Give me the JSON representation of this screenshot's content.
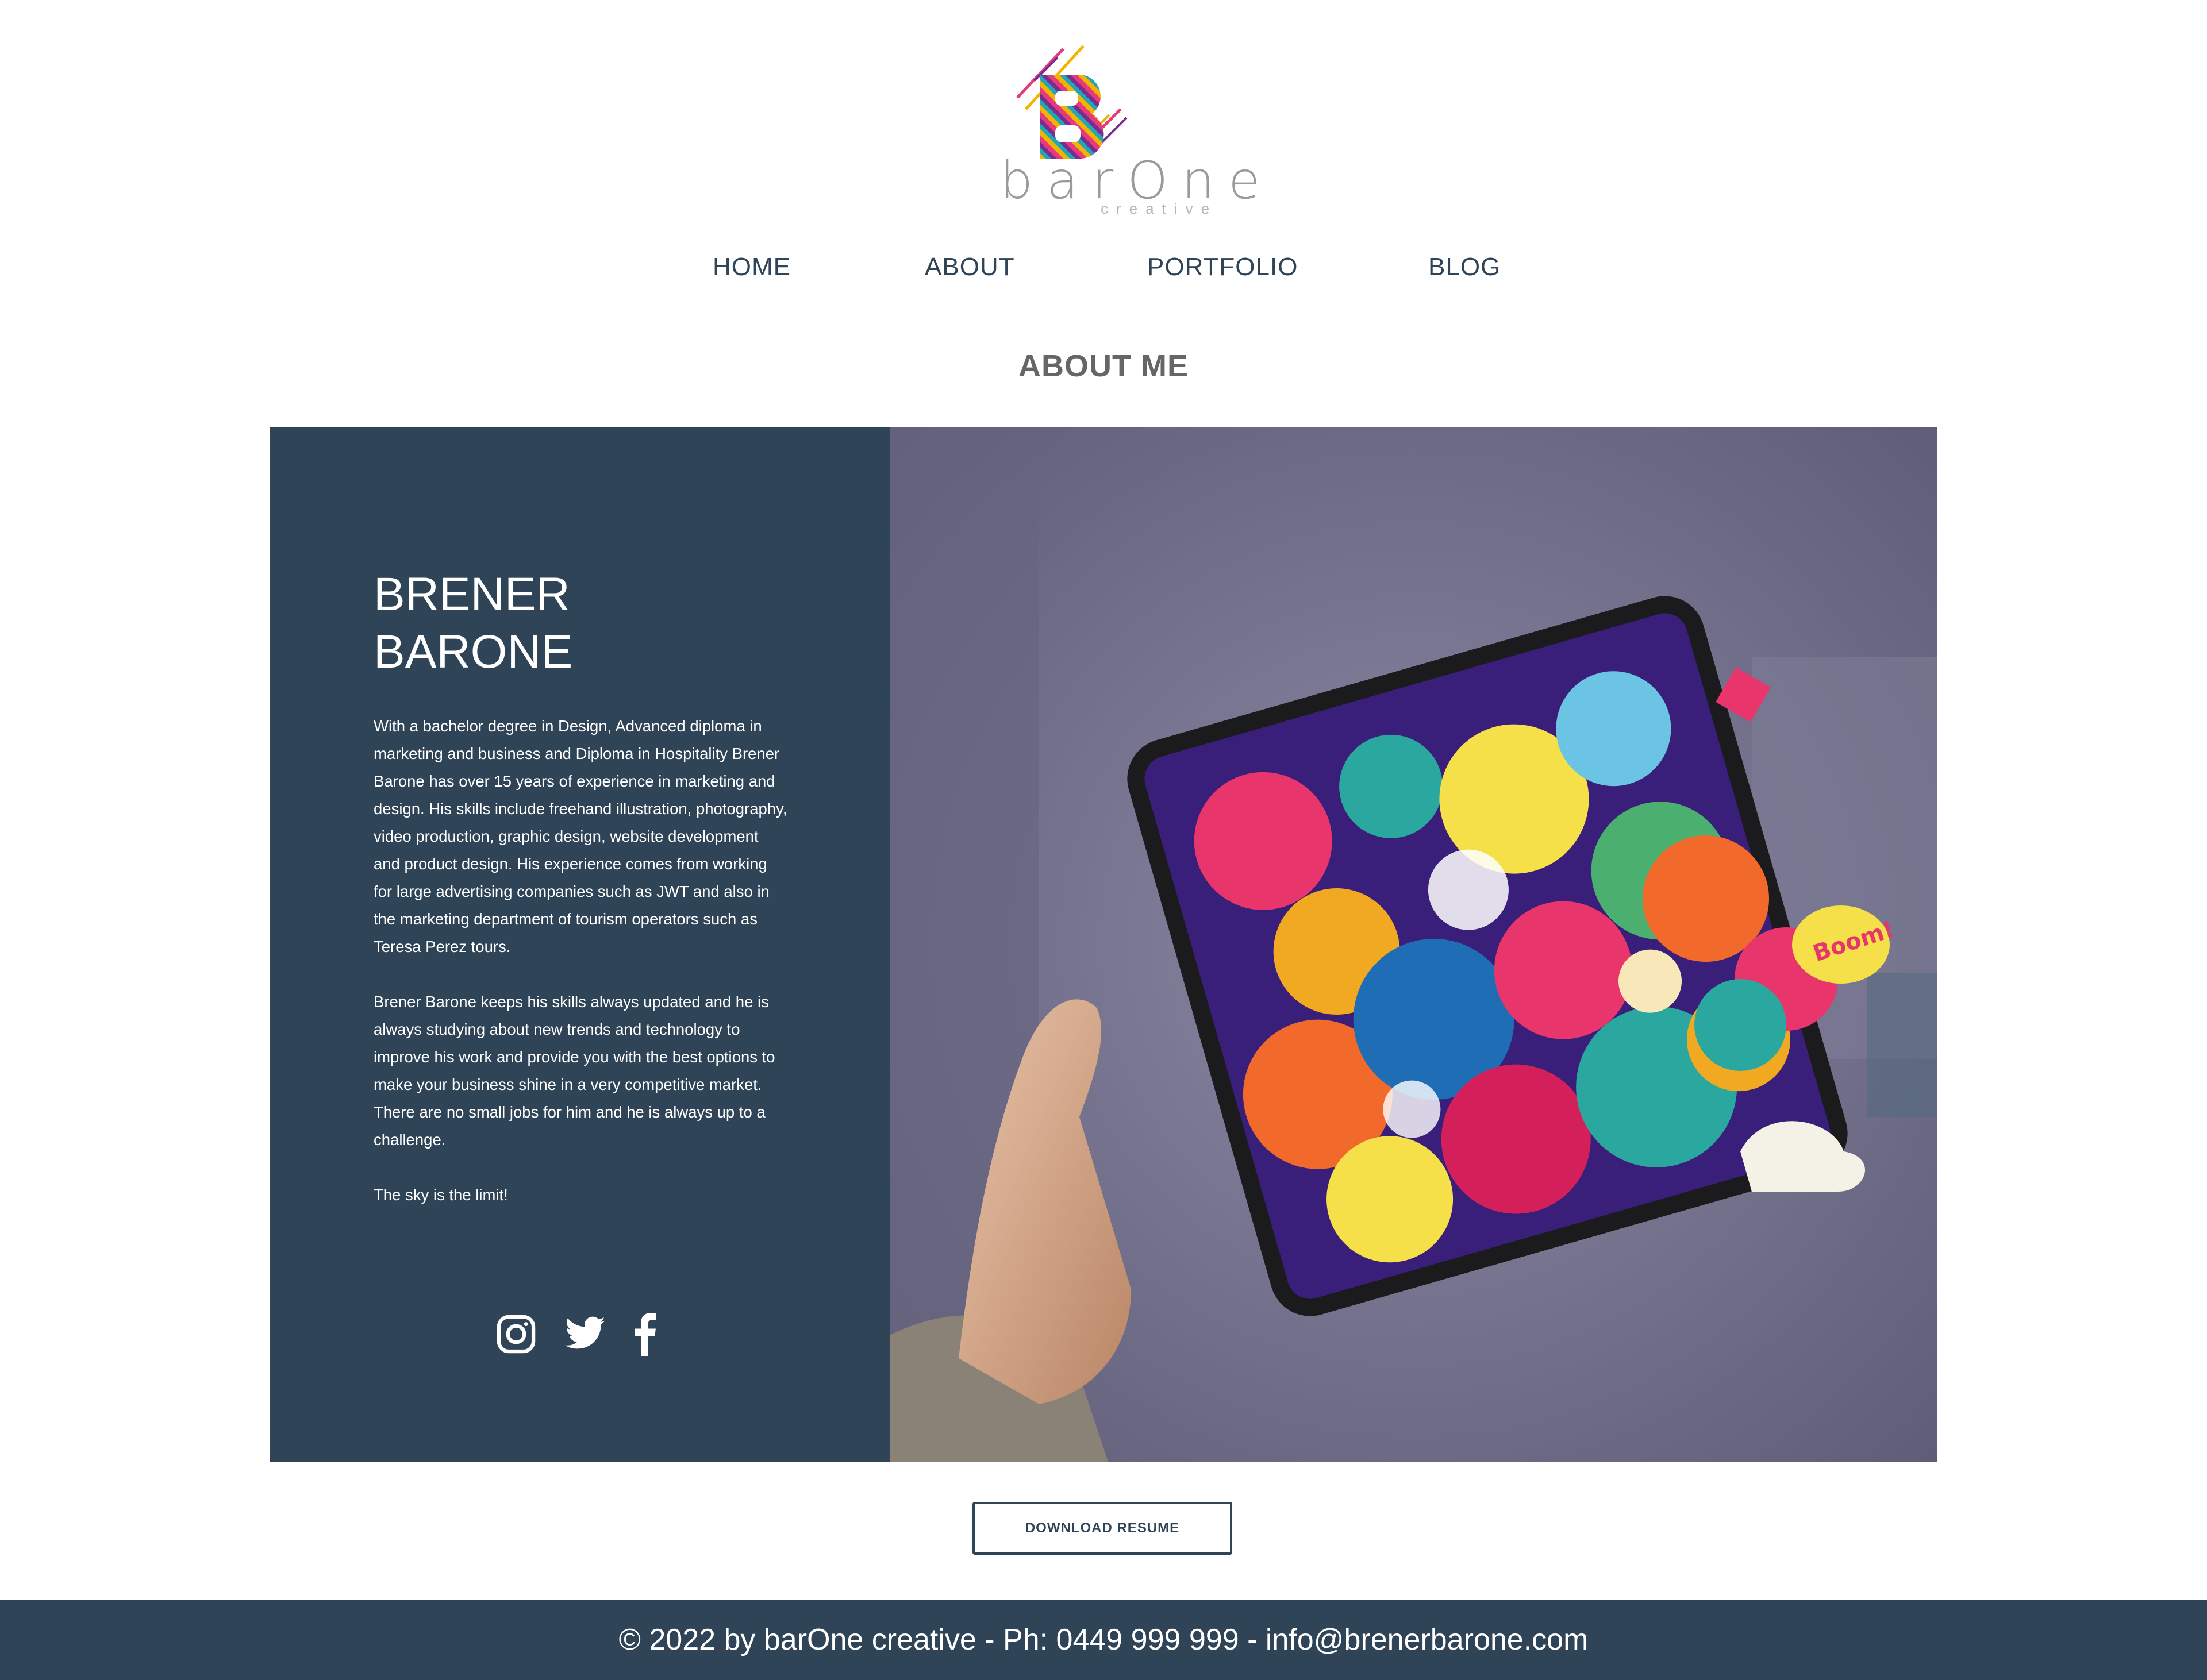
{
  "logo": {
    "wordmark": "barOne",
    "subtitle": "creative",
    "icon": "barone-b-logo-icon"
  },
  "nav": {
    "items": [
      {
        "label": "HOME"
      },
      {
        "label": "ABOUT"
      },
      {
        "label": "PORTFOLIO"
      },
      {
        "label": "BLOG"
      }
    ]
  },
  "about": {
    "title": "ABOUT ME",
    "name_line1": "BRENER",
    "name_line2": "BARONE",
    "bio": [
      "With a bachelor degree in Design, Advanced diploma in marketing and business and Diploma in Hospitality Brener Barone has over 15 years of experience in marketing and design. His skills include freehand illustration, photography, video production, graphic design, website development and product design. His experience comes from working for large advertising companies such as JWT and also in the marketing department of tourism operators such as Teresa Perez tours.",
      "Brener Barone keeps his skills always updated and he is always studying about new trends and technology to improve his work and provide you with the best options to make your business shine in a very competitive market. There are no small jobs for him and he is always up to a challenge.",
      "The sky is the limit!"
    ],
    "social": [
      {
        "icon": "instagram-icon"
      },
      {
        "icon": "twitter-icon"
      },
      {
        "icon": "facebook-icon"
      }
    ],
    "image_alt": "hand holding tablet with colorful illustration"
  },
  "resume_button": "DOWNLOAD RESUME",
  "footer": {
    "text": "© 2022 by barOne creative - Ph: 0449 999 999 - info@brenerbarone.com"
  },
  "colors": {
    "navy": "#2f4457",
    "heading_gray": "#666666",
    "image_bg": "#6f6d88"
  }
}
